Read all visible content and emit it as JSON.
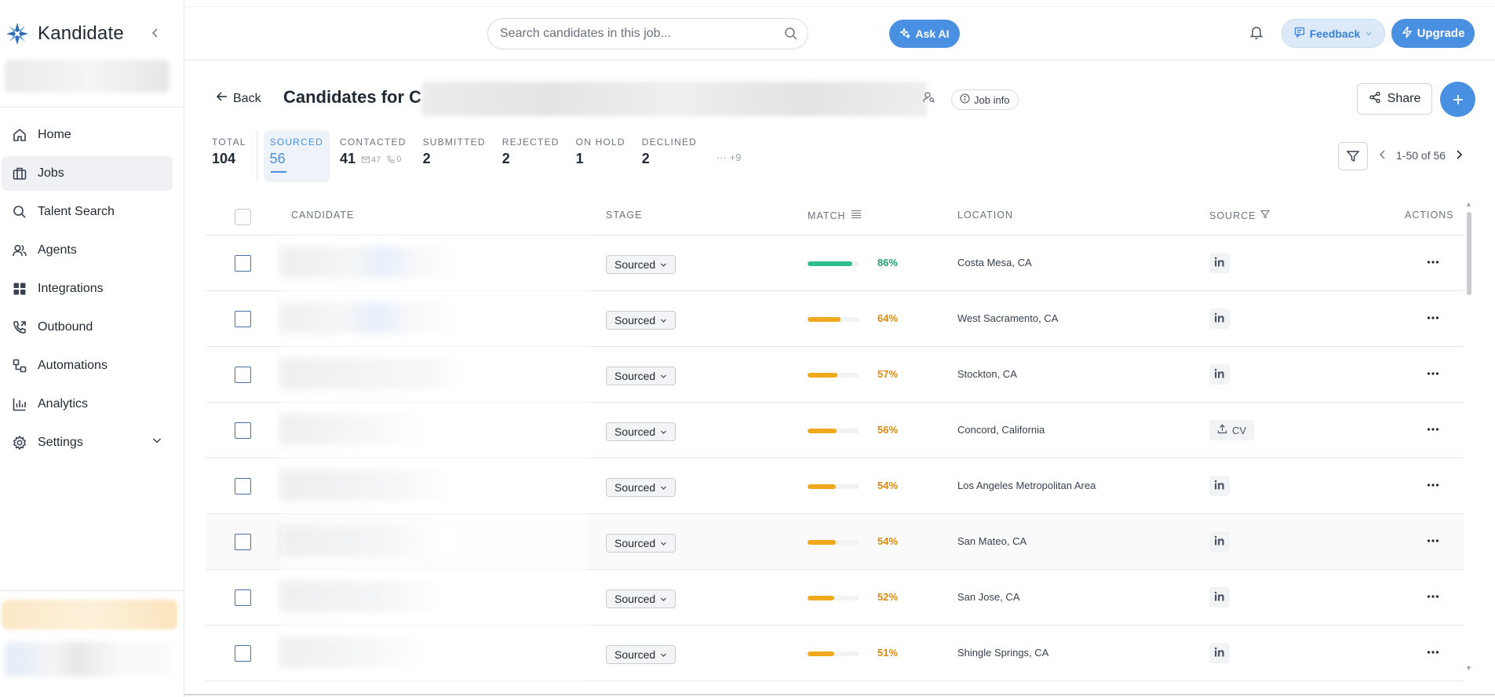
{
  "brand": {
    "name": "Kandidate"
  },
  "sidebar": {
    "items": [
      {
        "label": "Home",
        "icon": "home-icon",
        "active": false
      },
      {
        "label": "Jobs",
        "icon": "briefcase-icon",
        "active": true
      },
      {
        "label": "Talent Search",
        "icon": "search-icon",
        "active": false
      },
      {
        "label": "Agents",
        "icon": "users-icon",
        "active": false
      },
      {
        "label": "Integrations",
        "icon": "grid-icon",
        "active": false
      },
      {
        "label": "Outbound",
        "icon": "phone-outgoing-icon",
        "active": false
      },
      {
        "label": "Automations",
        "icon": "workflow-icon",
        "active": false
      },
      {
        "label": "Analytics",
        "icon": "bar-chart-icon",
        "active": false
      },
      {
        "label": "Settings",
        "icon": "gear-icon",
        "active": false,
        "expandable": true
      }
    ]
  },
  "topbar": {
    "search_placeholder": "Search candidates in this job...",
    "ask_ai_label": "Ask AI",
    "feedback_label": "Feedback",
    "upgrade_label": "Upgrade"
  },
  "header": {
    "back_label": "Back",
    "title": "Candidates for C",
    "job_info_label": "Job info",
    "share_label": "Share"
  },
  "stages": {
    "total": {
      "label": "TOTAL",
      "count": "104"
    },
    "tabs": [
      {
        "label": "SOURCED",
        "count": "56",
        "active": true
      },
      {
        "label": "CONTACTED",
        "count": "41",
        "emails": "47",
        "calls": "0"
      },
      {
        "label": "SUBMITTED",
        "count": "2"
      },
      {
        "label": "REJECTED",
        "count": "2"
      },
      {
        "label": "ON HOLD",
        "count": "1"
      },
      {
        "label": "DECLINED",
        "count": "2"
      }
    ],
    "more_label": "+9"
  },
  "pagination": {
    "range": "1-50 of 56"
  },
  "table": {
    "columns": {
      "candidate": "CANDIDATE",
      "stage": "STAGE",
      "match": "MATCH",
      "location": "LOCATION",
      "source": "SOURCE",
      "actions": "ACTIONS"
    },
    "rows": [
      {
        "stage": "Sourced",
        "match": "86%",
        "match_value": 0.86,
        "match_color": "#2fbf8a",
        "location": "Costa Mesa, CA",
        "source": "linkedin"
      },
      {
        "stage": "Sourced",
        "match": "64%",
        "match_value": 0.64,
        "match_color": "#f0a81c",
        "location": "West Sacramento, CA",
        "source": "linkedin"
      },
      {
        "stage": "Sourced",
        "match": "57%",
        "match_value": 0.57,
        "match_color": "#f0a81c",
        "location": "Stockton, CA",
        "source": "linkedin"
      },
      {
        "stage": "Sourced",
        "match": "56%",
        "match_value": 0.56,
        "match_color": "#f0a81c",
        "location": "Concord, California",
        "source": "cv",
        "source_label": "CV"
      },
      {
        "stage": "Sourced",
        "match": "54%",
        "match_value": 0.54,
        "match_color": "#f0a81c",
        "location": "Los Angeles Metropolitan Area",
        "source": "linkedin"
      },
      {
        "stage": "Sourced",
        "match": "54%",
        "match_value": 0.54,
        "match_color": "#f0a81c",
        "location": "San Mateo, CA",
        "source": "linkedin"
      },
      {
        "stage": "Sourced",
        "match": "52%",
        "match_value": 0.52,
        "match_color": "#f0a81c",
        "location": "San Jose, CA",
        "source": "linkedin"
      },
      {
        "stage": "Sourced",
        "match": "51%",
        "match_value": 0.51,
        "match_color": "#f0a81c",
        "location": "Shingle Springs, CA",
        "source": "linkedin"
      }
    ]
  },
  "colors": {
    "accent": "#4a90e2",
    "match_high": "#2fbf8a",
    "match_mid": "#f0a81c",
    "match_high_text": "#1f9e6e",
    "match_mid_text": "#d88a10"
  }
}
